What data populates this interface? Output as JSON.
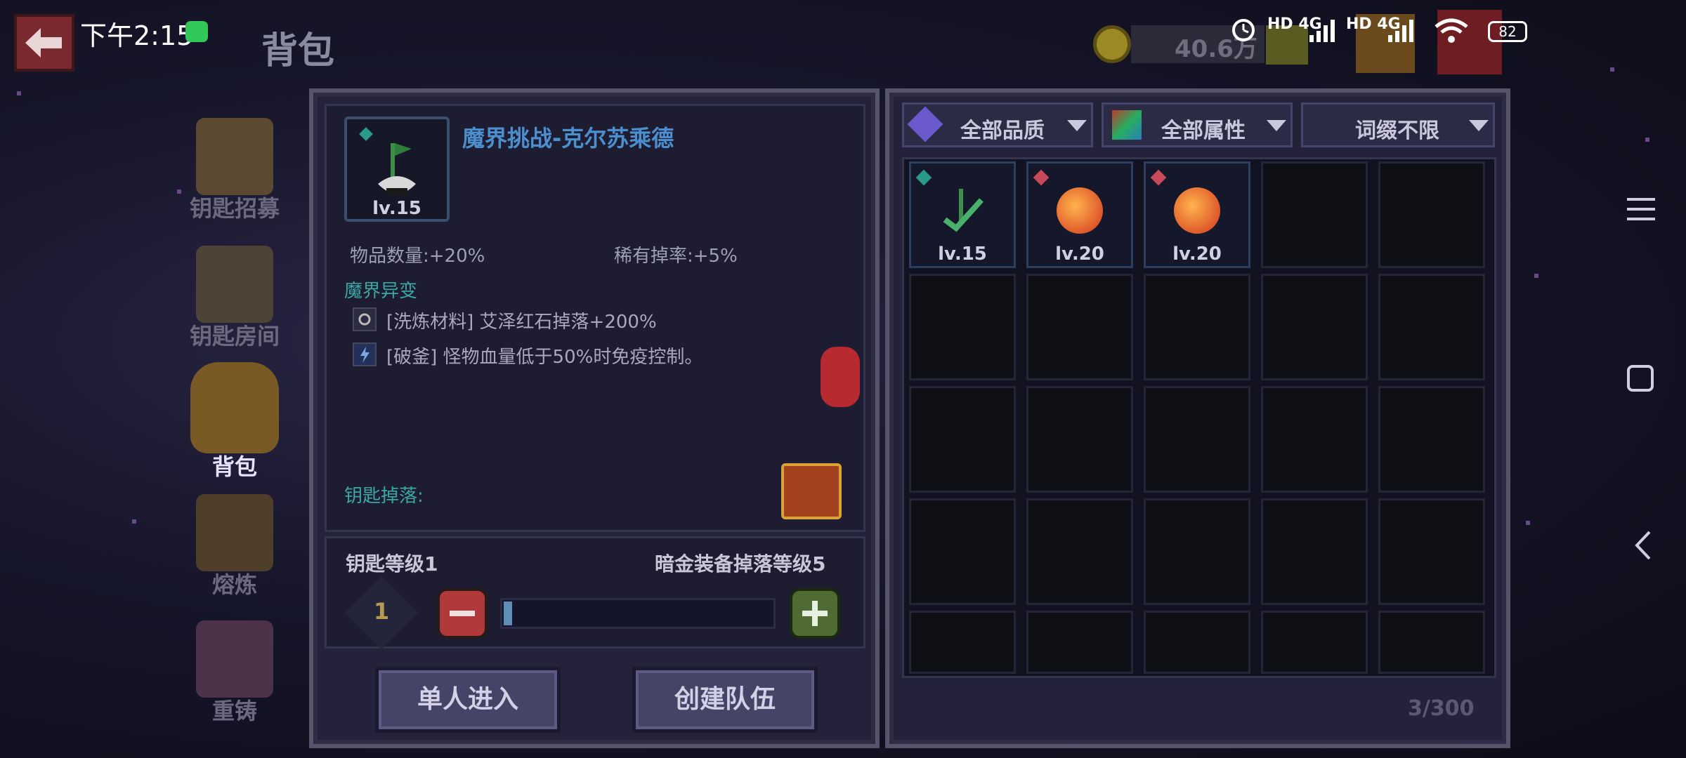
{
  "status_bar": {
    "time": "下午2:15",
    "network": "HD 4G",
    "network2": "HD 4G",
    "battery": "82"
  },
  "header": {
    "title": "背包",
    "coins": "40.6万"
  },
  "side_menu": [
    {
      "label": "钥匙招募",
      "active": false,
      "color": "#6b5a3a"
    },
    {
      "label": "钥匙房间",
      "active": false,
      "color": "#5c4e3c"
    },
    {
      "label": "背包",
      "active": true,
      "color": "#8a6b2a"
    },
    {
      "label": "熔炼",
      "active": false,
      "color": "#5c4630"
    },
    {
      "label": "重铸",
      "active": false,
      "color": "#5a3a56"
    }
  ],
  "key_detail": {
    "level_badge": "lv.15",
    "title": "魔界挑战-克尔苏乘德",
    "stat_left": "物品数量:+20%",
    "stat_right": "稀有掉率:+5%",
    "mutation_title": "魔界异变",
    "affixes": [
      "[洗炼材料] 艾泽红石掉落+200%",
      "[破釜] 怪物血量低于50%时免疫控制。"
    ],
    "drop_label": "钥匙掉落:"
  },
  "level_control": {
    "key_level_label": "钥匙等级1",
    "drop_level_label": "暗金装备掉落等级5",
    "value": "1",
    "progress": 0.02
  },
  "actions": {
    "solo": "单人进入",
    "team": "创建队伍"
  },
  "filters": {
    "quality": "全部品质",
    "attribute": "全部属性",
    "affix": "词缀不限"
  },
  "inventory": {
    "items": [
      {
        "level": "lv.15",
        "type": "key-flag-icon"
      },
      {
        "level": "lv.20",
        "type": "fruit-icon"
      },
      {
        "level": "lv.20",
        "type": "fruit-icon"
      }
    ],
    "count": "3/300"
  }
}
